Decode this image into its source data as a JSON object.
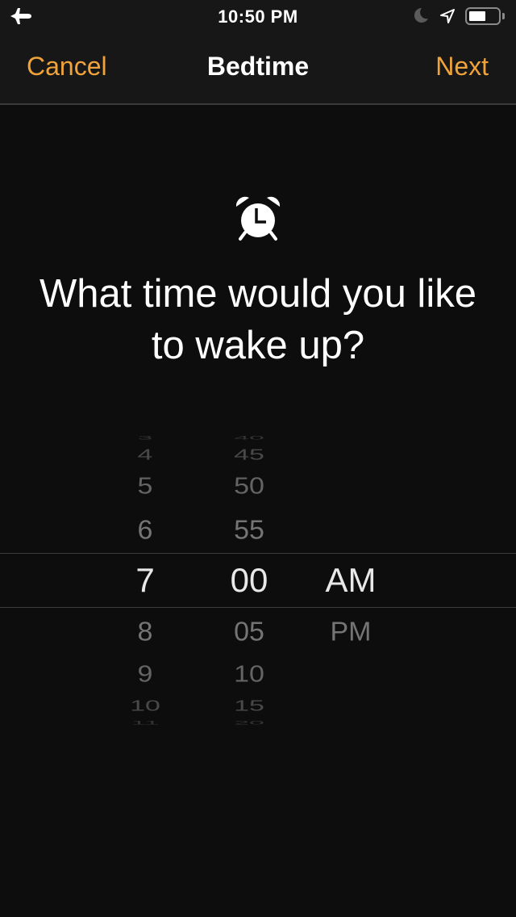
{
  "status_bar": {
    "time": "10:50 PM",
    "icons": [
      "airplane-icon",
      "moon-icon",
      "location-arrow-icon",
      "battery-icon"
    ],
    "battery_level_percent": 50
  },
  "nav": {
    "cancel_label": "Cancel",
    "title": "Bedtime",
    "next_label": "Next",
    "accent_color": "#f0a33a"
  },
  "main": {
    "icon": "alarm-clock-icon",
    "question_line1": "What time would you like",
    "question_line2": "to wake up?"
  },
  "picker": {
    "hours": [
      "3",
      "4",
      "5",
      "6",
      "7",
      "8",
      "9",
      "10",
      "11"
    ],
    "minutes": [
      "40",
      "45",
      "50",
      "55",
      "00",
      "05",
      "10",
      "15",
      "20"
    ],
    "periods": [
      "AM",
      "PM"
    ],
    "selected": {
      "hour": "7",
      "minute": "00",
      "period": "AM"
    }
  }
}
